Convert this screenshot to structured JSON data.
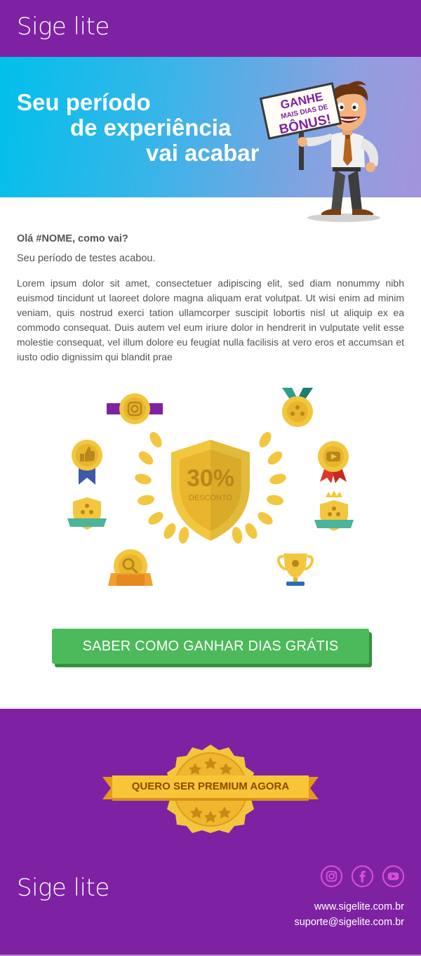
{
  "header": {
    "logo": "Sige lite"
  },
  "hero": {
    "title_lines": [
      "Seu período",
      "de experiência",
      "vai acabar"
    ],
    "sign_lines": [
      "GANHE",
      "MAIS DIAS DE",
      "BÔNUS!"
    ]
  },
  "content": {
    "greeting": "Olá #NOME, como vai?",
    "intro": "Seu período de testes acabou.",
    "body": "Lorem ipsum dolor sit amet, consectetuer adipiscing elit, sed diam nonummy nibh euismod tincidunt ut laoreet dolore magna aliquam erat volutpat. Ut wisi enim ad minim veniam, quis nostrud exerci tation ullamcorper suscipit lobortis nisl ut aliquip ex ea commodo consequat. Duis autem vel eum iriure dolor in hendrerit in vulputate velit esse molestie consequat, vel illum dolore eu feugiat nulla facilisis at vero eros et accumsan et iusto odio dignissim qui blandit prae"
  },
  "badges": {
    "discount_value": "30%",
    "discount_label": "DESCONTO",
    "icons": [
      "instagram-badge-icon",
      "users-medal-icon",
      "thumbs-up-badge-icon",
      "youtube-badge-icon",
      "team-shield-badge-icon",
      "crown-team-badge-icon",
      "search-badge-icon",
      "trophy-icon"
    ]
  },
  "cta": {
    "label": "SABER COMO GANHAR DIAS GRÁTIS"
  },
  "footer": {
    "premium_label": "QUERO SER PREMIUM AGORA",
    "logo": "Sige lite",
    "social": [
      "instagram-icon",
      "facebook-icon",
      "youtube-icon"
    ],
    "website": "www.sigelite.com.br",
    "email": "suporte@sigelite.com.br"
  },
  "colors": {
    "brand_purple": "#7e22a3",
    "hero_gradient_start": "#00c0ea",
    "hero_gradient_end": "#a393dc",
    "gold": "#f5c842",
    "cta_green": "#4cb95a",
    "text_gray": "#555555"
  }
}
